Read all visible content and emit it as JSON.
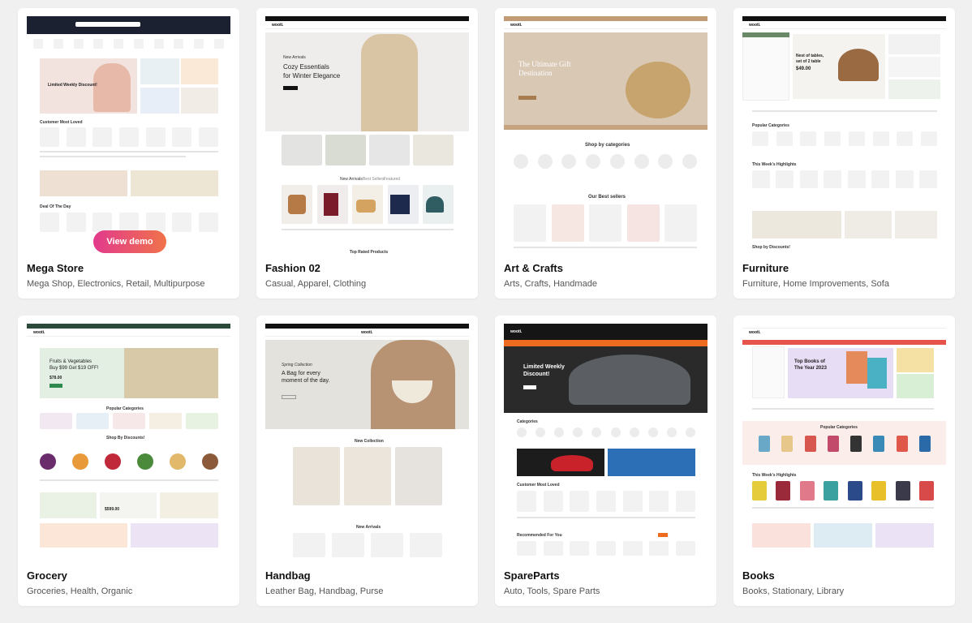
{
  "view_demo_label": "View demo",
  "cards": [
    {
      "title": "Mega Store",
      "tags": "Mega Shop, Electronics, Retail, Multipurpose",
      "preview": {
        "hero": "Limited Weekly Discount!",
        "section1": "Customer Most Loved",
        "section2": "Deal Of The Day"
      }
    },
    {
      "title": "Fashion 02",
      "tags": "Casual, Apparel, Clothing",
      "preview": {
        "logo": "wooti.",
        "eyebrow": "New Arrivals",
        "hero_line1": "Cozy Essentials",
        "hero_line2": "for Winter Elegance",
        "tab1": "New Arrivals",
        "tab2": "Best Sellers",
        "tab3": "Featured",
        "section": "Top Rated Products"
      }
    },
    {
      "title": "Art & Crafts",
      "tags": "Arts, Crafts, Handmade",
      "preview": {
        "logo": "wooti.",
        "hero_line1": "The Ultimate Gift",
        "hero_line2": "Destination",
        "section1": "Shop by categories",
        "section2": "Our Best sellers"
      }
    },
    {
      "title": "Furniture",
      "tags": "Furniture, Home Improvements, Sofa",
      "preview": {
        "logo": "wooti.",
        "hero_line1": "Nest of tables,",
        "hero_line2": "set of 2 table",
        "price": "$49.00",
        "section1": "Popular Categories",
        "section2": "This Week's Highlights",
        "section3": "Shop by Discounts!"
      }
    },
    {
      "title": "Grocery",
      "tags": "Groceries, Health, Organic",
      "preview": {
        "logo": "wooti.",
        "hero_line1": "Fruits & Vegetables",
        "hero_line2": "Buy $99 Get $19 OFF!",
        "price": "$78.00",
        "section1": "Popular Categories",
        "section2": "Shop By Discounts!",
        "promo": "$599.00"
      }
    },
    {
      "title": "Handbag",
      "tags": "Leather Bag, Handbag, Purse",
      "preview": {
        "logo": "wooti.",
        "eyebrow": "Spring Collection",
        "hero_line1": "A Bag for every",
        "hero_line2": "moment of the day.",
        "section1": "New Collection",
        "section2": "New Arrivals"
      }
    },
    {
      "title": "SpareParts",
      "tags": "Auto, Tools, Spare Parts",
      "preview": {
        "logo": "wooti.",
        "hero_line1": "Limited Weekly",
        "hero_line2": "Discount!",
        "section1": "Categories",
        "section2": "Customer Most Loved",
        "section3": "Recommended For You"
      }
    },
    {
      "title": "Books",
      "tags": "Books, Stationary, Library",
      "preview": {
        "logo": "wooti.",
        "hero_line1": "Top Books of",
        "hero_line2": "The Year 2023",
        "section1": "Popular Categories",
        "section2": "This Week's Highlights"
      }
    }
  ]
}
